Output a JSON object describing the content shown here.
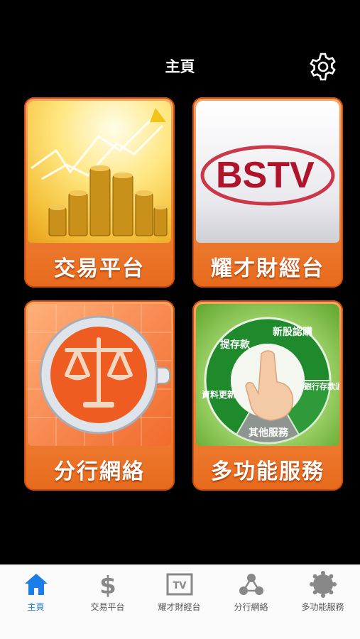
{
  "header": {
    "title": "主頁",
    "settings_icon": "gear-icon"
  },
  "tiles": [
    {
      "label": "交易平台",
      "icon": "coins-chart-image"
    },
    {
      "label": "耀才財經台",
      "icon": "bstv-logo",
      "logo_text": "BSTV"
    },
    {
      "label": "分行網絡",
      "icon": "scales-image"
    },
    {
      "label": "多功能服務",
      "icon": "service-wheel-image",
      "wheel_items": [
        "提存款",
        "新股認購",
        "銀行存款通知",
        "其他服務",
        "資料更新"
      ]
    }
  ],
  "tabbar": {
    "active_color": "#1a7de8",
    "inactive_color": "#555555",
    "items": [
      {
        "label": "主頁",
        "icon": "home-icon",
        "active": true
      },
      {
        "label": "交易平台",
        "icon": "dollar-icon",
        "active": false
      },
      {
        "label": "耀才財經台",
        "icon": "tv-icon",
        "active": false
      },
      {
        "label": "分行網絡",
        "icon": "network-icon",
        "active": false
      },
      {
        "label": "多功能服務",
        "icon": "gear-badge-icon",
        "active": false
      }
    ]
  }
}
